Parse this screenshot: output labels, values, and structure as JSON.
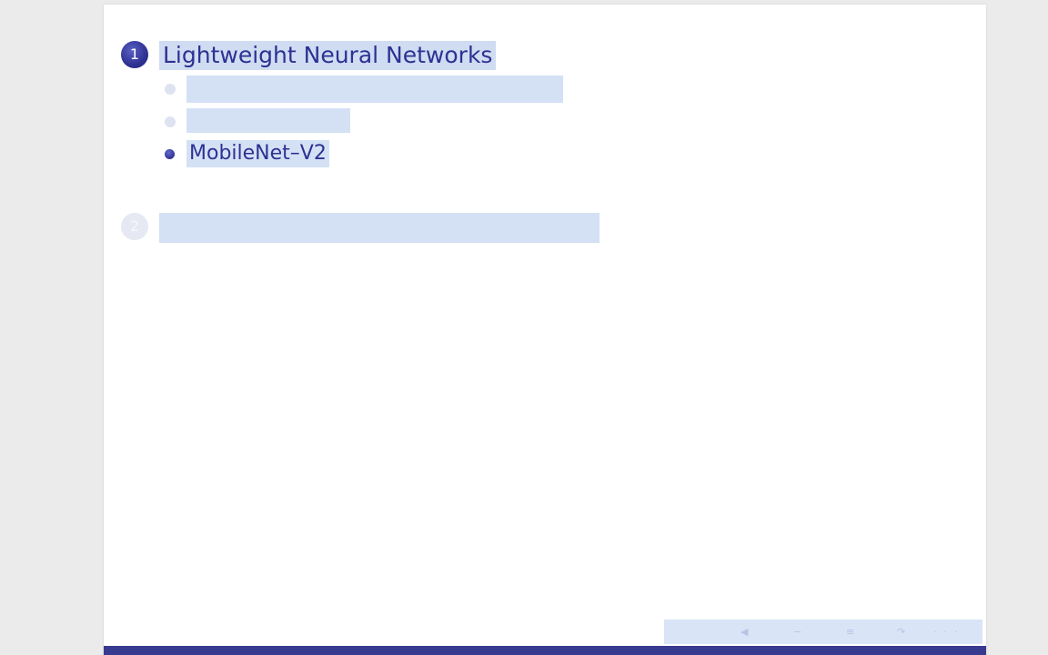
{
  "outline": {
    "sections": [
      {
        "number": "1",
        "title": "Lightweight Neural Networks",
        "state": "active",
        "subsections": [
          {
            "label": "",
            "state": "dim"
          },
          {
            "label": "",
            "state": "dim"
          },
          {
            "label": "MobileNet–V2",
            "state": "active"
          }
        ]
      },
      {
        "number": "2",
        "title": "",
        "state": "dim"
      }
    ]
  },
  "navigation": {
    "icons": [
      "nav-frame-prev-icon",
      "nav-subsection-icon",
      "nav-section-icon",
      "nav-find-icon",
      "nav-more-icon"
    ]
  },
  "footer": {
    "author": "",
    "title": "",
    "date_page": ""
  },
  "colors": {
    "accent": "#2f3192",
    "highlight": "#d4e1f5",
    "footer_bg": "#383a8f"
  }
}
